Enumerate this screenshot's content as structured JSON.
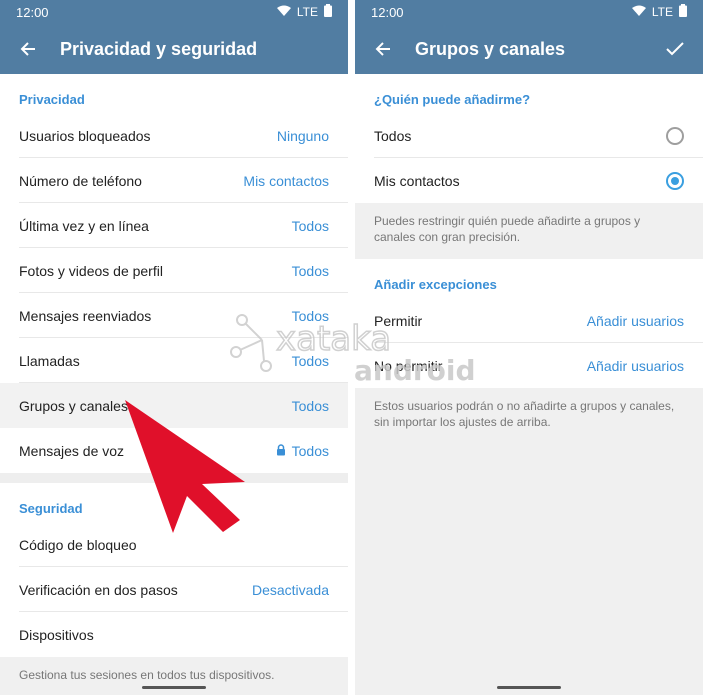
{
  "status": {
    "time": "12:00",
    "network": "LTE"
  },
  "left": {
    "title": "Privacidad y seguridad",
    "privacy_section": "Privacidad",
    "privacy_rows": [
      {
        "label": "Usuarios bloqueados",
        "value": "Ninguno"
      },
      {
        "label": "Número de teléfono",
        "value": "Mis contactos"
      },
      {
        "label": "Última vez y en línea",
        "value": "Todos"
      },
      {
        "label": "Fotos y videos de perfil",
        "value": "Todos"
      },
      {
        "label": "Mensajes reenviados",
        "value": "Todos"
      },
      {
        "label": "Llamadas",
        "value": "Todos"
      },
      {
        "label": "Grupos y canales",
        "value": "Todos"
      },
      {
        "label": "Mensajes de voz",
        "value": "Todos"
      }
    ],
    "security_section": "Seguridad",
    "security_rows": [
      {
        "label": "Código de bloqueo",
        "value": ""
      },
      {
        "label": "Verificación en dos pasos",
        "value": "Desactivada"
      },
      {
        "label": "Dispositivos",
        "value": ""
      }
    ],
    "devices_note": "Gestiona tus sesiones en todos tus dispositivos."
  },
  "right": {
    "title": "Grupos y canales",
    "who_section": "¿Quién puede añadirme?",
    "options": [
      {
        "label": "Todos",
        "selected": false
      },
      {
        "label": "Mis contactos",
        "selected": true
      }
    ],
    "who_note": "Puedes restringir quién puede añadirte a grupos y canales con gran precisión.",
    "exceptions_section": "Añadir excepciones",
    "exception_rows": [
      {
        "label": "Permitir",
        "value": "Añadir usuarios"
      },
      {
        "label": "No permitir",
        "value": "Añadir usuarios"
      }
    ],
    "exceptions_note": "Estos usuarios podrán o no añadirte a grupos y canales, sin importar los ajustes de arriba."
  },
  "watermark": {
    "line1": "xataka",
    "line2": "android"
  },
  "colors": {
    "header": "#517da2",
    "accent": "#3a8fd6",
    "arrow": "#e0102a",
    "radio": "#3a9fe0"
  }
}
